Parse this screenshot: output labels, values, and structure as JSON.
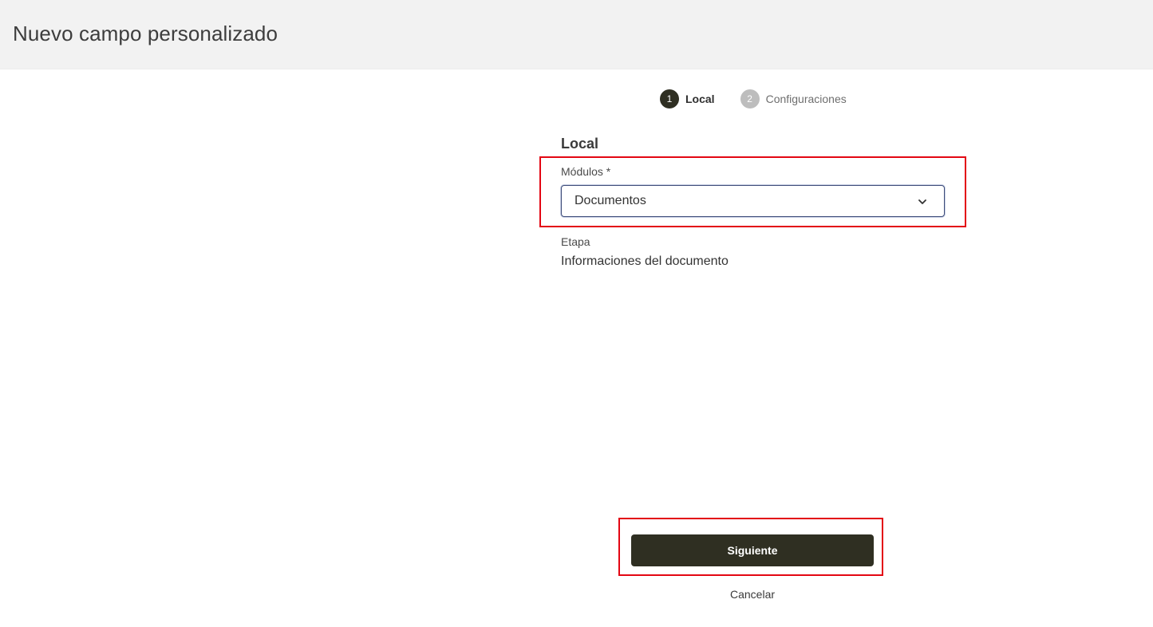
{
  "header": {
    "title": "Nuevo campo personalizado"
  },
  "stepper": {
    "steps": [
      {
        "number": "1",
        "label": "Local",
        "state": "active"
      },
      {
        "number": "2",
        "label": "Configuraciones",
        "state": "inactive"
      }
    ]
  },
  "form": {
    "section_title": "Local",
    "modules": {
      "label": "Módulos *",
      "value": "Documentos",
      "icon": "chevron-down-icon"
    },
    "etapa": {
      "label": "Etapa",
      "value": "Informaciones del documento"
    }
  },
  "actions": {
    "next_label": "Siguiente",
    "cancel_label": "Cancelar"
  },
  "colors": {
    "primary": "#2f2f22",
    "highlight": "#e30613",
    "header_bg": "#f2f2f2",
    "inactive_step": "#bdbdbd"
  }
}
